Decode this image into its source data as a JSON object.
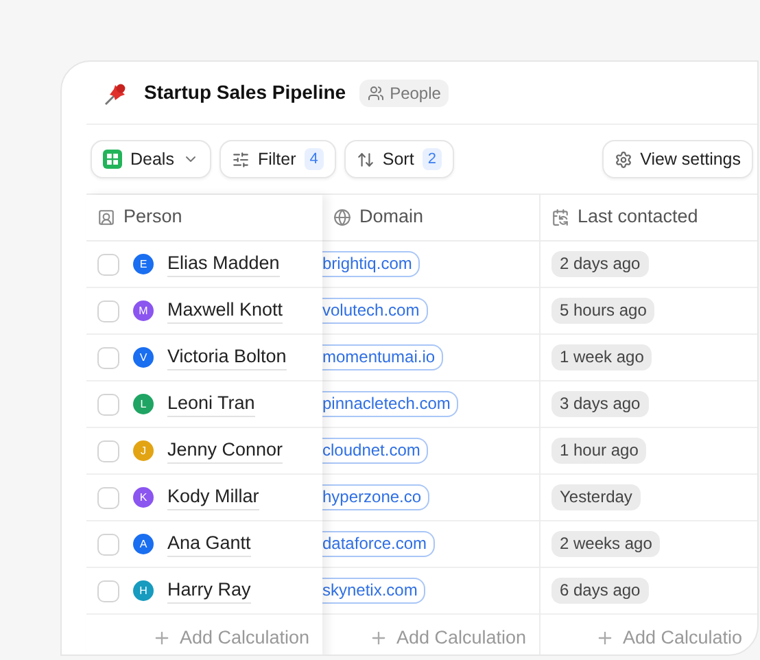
{
  "header": {
    "title": "Startup Sales Pipeline",
    "tag": "People"
  },
  "toolbar": {
    "view": {
      "label": "Deals"
    },
    "filter": {
      "label": "Filter",
      "count": "4"
    },
    "sort": {
      "label": "Sort",
      "count": "2"
    },
    "settings": {
      "label": "View settings"
    }
  },
  "table": {
    "columns": [
      {
        "label": "Person",
        "kind": "person"
      },
      {
        "label": "Domain",
        "kind": "domain"
      },
      {
        "label": "Last contacted",
        "kind": "date"
      }
    ],
    "rows": [
      {
        "checked": false,
        "initial": "E",
        "color": "#1a6ef0",
        "name": "Elias Madden",
        "domain": "brightiq.com",
        "last_contacted": "2 days ago"
      },
      {
        "checked": false,
        "initial": "M",
        "color": "#8b55f0",
        "name": "Maxwell Knott",
        "domain": "volutech.com",
        "last_contacted": "5 hours ago"
      },
      {
        "checked": false,
        "initial": "V",
        "color": "#1a6ef0",
        "name": "Victoria Bolton",
        "domain": "momentumai.io",
        "last_contacted": "1 week ago"
      },
      {
        "checked": false,
        "initial": "L",
        "color": "#1fa463",
        "name": "Leoni Tran",
        "domain": "pinnacletech.com",
        "last_contacted": "3 days ago"
      },
      {
        "checked": false,
        "initial": "J",
        "color": "#e3a414",
        "name": "Jenny Connor",
        "domain": "cloudnet.com",
        "last_contacted": "1 hour ago"
      },
      {
        "checked": false,
        "initial": "K",
        "color": "#8b55f0",
        "name": "Kody Millar",
        "domain": "hyperzone.co",
        "last_contacted": "Yesterday"
      },
      {
        "checked": false,
        "initial": "A",
        "color": "#1a6ef0",
        "name": "Ana Gantt",
        "domain": "dataforce.com",
        "last_contacted": "2 weeks ago"
      },
      {
        "checked": false,
        "initial": "H",
        "color": "#179bbf",
        "name": "Harry Ray",
        "domain": "skynetix.com",
        "last_contacted": "6 days ago"
      }
    ],
    "footer": [
      "Add Calculation",
      "Add Calculation",
      "Add Calculatio"
    ]
  }
}
